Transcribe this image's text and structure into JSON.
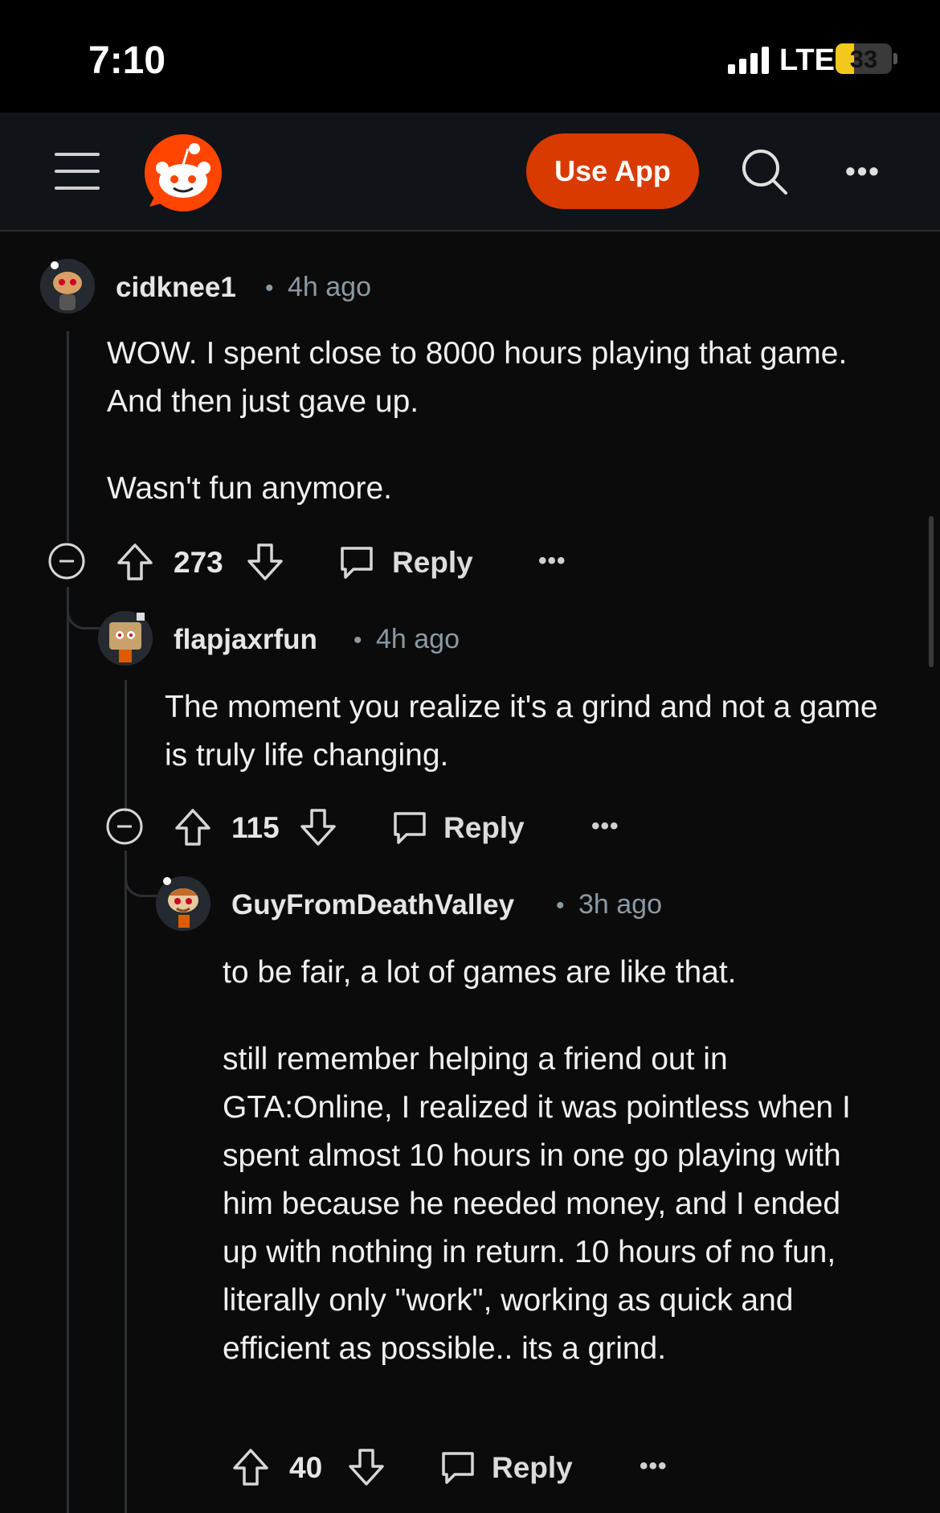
{
  "status_bar": {
    "time": "7:10",
    "network": "LTE",
    "battery": "33",
    "battery_level": 0.33
  },
  "header": {
    "use_app_label": "Use App",
    "icons": [
      "menu-icon",
      "reddit-logo",
      "search-icon",
      "more-icon"
    ]
  },
  "colors": {
    "accent": "#d93a00",
    "background": "#0b0b0b",
    "meta": "#8a9aa4"
  },
  "comments": [
    {
      "author": "cidknee1",
      "separator": "•",
      "time": "4h ago",
      "body": [
        "WOW. I spent close to 8000 hours playing that game. And then just gave up.",
        "Wasn't fun anymore."
      ],
      "score": "273",
      "reply_label": "Reply",
      "more": "•••"
    },
    {
      "author": "flapjaxrfun",
      "separator": "•",
      "time": "4h ago",
      "body": [
        "The moment you realize it's a grind and not a game is truly life changing."
      ],
      "score": "115",
      "reply_label": "Reply",
      "more": "•••"
    },
    {
      "author": "GuyFromDeathValley",
      "separator": "•",
      "time": "3h ago",
      "body": [
        "to be fair, a lot of games are like that.",
        "still remember helping a friend out in GTA:Online, I realized it was pointless when I spent almost 10 hours in one go playing with him because he needed money, and I ended up with nothing in return. 10 hours of no fun, literally only \"work\", working as quick and efficient as possible.. its a grind."
      ],
      "score": "40",
      "reply_label": "Reply",
      "more": "•••"
    }
  ]
}
